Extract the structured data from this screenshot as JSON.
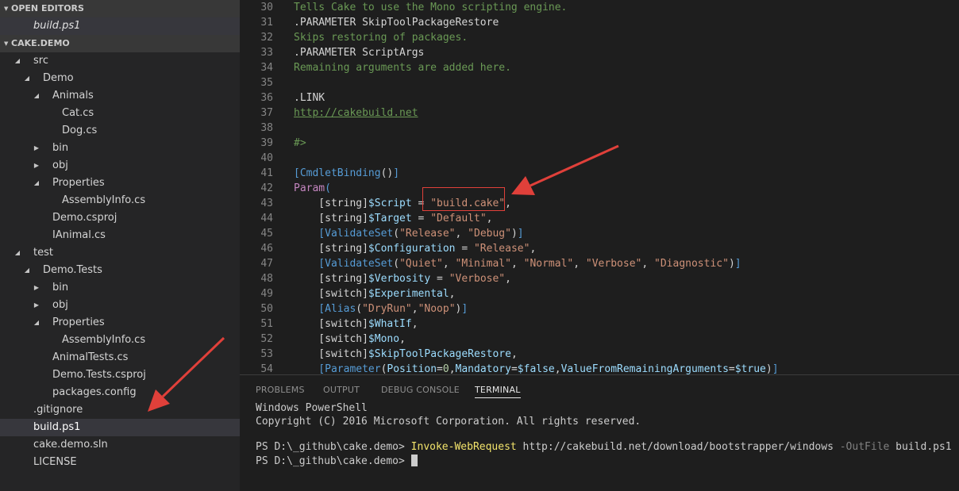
{
  "explorer": {
    "open_editors_title": "OPEN EDITORS",
    "open_editors": [
      "build.ps1"
    ],
    "project_title": "CAKE.DEMO",
    "tree": [
      {
        "label": "src",
        "depth": 0,
        "twisty": "open"
      },
      {
        "label": "Demo",
        "depth": 1,
        "twisty": "open"
      },
      {
        "label": "Animals",
        "depth": 2,
        "twisty": "open"
      },
      {
        "label": "Cat.cs",
        "depth": 3,
        "twisty": "none"
      },
      {
        "label": "Dog.cs",
        "depth": 3,
        "twisty": "none"
      },
      {
        "label": "bin",
        "depth": 2,
        "twisty": "closed"
      },
      {
        "label": "obj",
        "depth": 2,
        "twisty": "closed"
      },
      {
        "label": "Properties",
        "depth": 2,
        "twisty": "open"
      },
      {
        "label": "AssemblyInfo.cs",
        "depth": 3,
        "twisty": "none"
      },
      {
        "label": "Demo.csproj",
        "depth": 2,
        "twisty": "none"
      },
      {
        "label": "IAnimal.cs",
        "depth": 2,
        "twisty": "none"
      },
      {
        "label": "test",
        "depth": 0,
        "twisty": "open"
      },
      {
        "label": "Demo.Tests",
        "depth": 1,
        "twisty": "open"
      },
      {
        "label": "bin",
        "depth": 2,
        "twisty": "closed"
      },
      {
        "label": "obj",
        "depth": 2,
        "twisty": "closed"
      },
      {
        "label": "Properties",
        "depth": 2,
        "twisty": "open"
      },
      {
        "label": "AssemblyInfo.cs",
        "depth": 3,
        "twisty": "none"
      },
      {
        "label": "AnimalTests.cs",
        "depth": 2,
        "twisty": "none"
      },
      {
        "label": "Demo.Tests.csproj",
        "depth": 2,
        "twisty": "none"
      },
      {
        "label": "packages.config",
        "depth": 2,
        "twisty": "none"
      },
      {
        "label": ".gitignore",
        "depth": 0,
        "twisty": "none"
      },
      {
        "label": "build.ps1",
        "depth": 0,
        "twisty": "none",
        "selected": true
      },
      {
        "label": "cake.demo.sln",
        "depth": 0,
        "twisty": "none"
      },
      {
        "label": "LICENSE",
        "depth": 0,
        "twisty": "none"
      }
    ]
  },
  "editor": {
    "lines": [
      {
        "n": "30",
        "tokens": [
          [
            "cm",
            "Tells Cake to use the Mono scripting engine."
          ]
        ]
      },
      {
        "n": "31",
        "tokens": [
          [
            "pl",
            ".PARAMETER SkipToolPackageRestore"
          ]
        ]
      },
      {
        "n": "32",
        "tokens": [
          [
            "cm",
            "Skips restoring of packages."
          ]
        ]
      },
      {
        "n": "33",
        "tokens": [
          [
            "pl",
            ".PARAMETER ScriptArgs"
          ]
        ]
      },
      {
        "n": "34",
        "tokens": [
          [
            "cm",
            "Remaining arguments are added here."
          ]
        ]
      },
      {
        "n": "35",
        "tokens": []
      },
      {
        "n": "36",
        "tokens": [
          [
            "pl",
            ".LINK"
          ]
        ]
      },
      {
        "n": "37",
        "tokens": [
          [
            "lk",
            "http://cakebuild.net"
          ]
        ]
      },
      {
        "n": "38",
        "tokens": []
      },
      {
        "n": "39",
        "tokens": [
          [
            "cm",
            "#>"
          ]
        ]
      },
      {
        "n": "40",
        "tokens": []
      },
      {
        "n": "41",
        "tokens": [
          [
            "at",
            "[CmdletBinding"
          ],
          [
            "pl",
            "()"
          ],
          [
            "at",
            "]"
          ]
        ]
      },
      {
        "n": "42",
        "tokens": [
          [
            "kw",
            "Param"
          ],
          [
            "at",
            "("
          ]
        ]
      },
      {
        "n": "43",
        "tokens": [
          [
            "pl",
            "    [string]"
          ],
          [
            "vr",
            "$Script"
          ],
          [
            "pl",
            " = "
          ],
          [
            "st",
            "\"build.cake\""
          ],
          [
            "pl",
            ","
          ]
        ]
      },
      {
        "n": "44",
        "tokens": [
          [
            "pl",
            "    [string]"
          ],
          [
            "vr",
            "$Target"
          ],
          [
            "pl",
            " = "
          ],
          [
            "st",
            "\"Default\""
          ],
          [
            "pl",
            ","
          ]
        ]
      },
      {
        "n": "45",
        "tokens": [
          [
            "at",
            "    [ValidateSet"
          ],
          [
            "pl",
            "("
          ],
          [
            "st",
            "\"Release\""
          ],
          [
            "pl",
            ", "
          ],
          [
            "st",
            "\"Debug\""
          ],
          [
            "pl",
            ")"
          ],
          [
            "at",
            "]"
          ]
        ]
      },
      {
        "n": "46",
        "tokens": [
          [
            "pl",
            "    [string]"
          ],
          [
            "vr",
            "$Configuration"
          ],
          [
            "pl",
            " = "
          ],
          [
            "st",
            "\"Release\""
          ],
          [
            "pl",
            ","
          ]
        ]
      },
      {
        "n": "47",
        "tokens": [
          [
            "at",
            "    [ValidateSet"
          ],
          [
            "pl",
            "("
          ],
          [
            "st",
            "\"Quiet\""
          ],
          [
            "pl",
            ", "
          ],
          [
            "st",
            "\"Minimal\""
          ],
          [
            "pl",
            ", "
          ],
          [
            "st",
            "\"Normal\""
          ],
          [
            "pl",
            ", "
          ],
          [
            "st",
            "\"Verbose\""
          ],
          [
            "pl",
            ", "
          ],
          [
            "st",
            "\"Diagnostic\""
          ],
          [
            "pl",
            ")"
          ],
          [
            "at",
            "]"
          ]
        ]
      },
      {
        "n": "48",
        "tokens": [
          [
            "pl",
            "    [string]"
          ],
          [
            "vr",
            "$Verbosity"
          ],
          [
            "pl",
            " = "
          ],
          [
            "st",
            "\"Verbose\""
          ],
          [
            "pl",
            ","
          ]
        ]
      },
      {
        "n": "49",
        "tokens": [
          [
            "pl",
            "    [switch]"
          ],
          [
            "vr",
            "$Experimental"
          ],
          [
            "pl",
            ","
          ]
        ]
      },
      {
        "n": "50",
        "tokens": [
          [
            "at",
            "    [Alias"
          ],
          [
            "pl",
            "("
          ],
          [
            "st",
            "\"DryRun\""
          ],
          [
            "pl",
            ","
          ],
          [
            "st",
            "\"Noop\""
          ],
          [
            "pl",
            ")"
          ],
          [
            "at",
            "]"
          ]
        ]
      },
      {
        "n": "51",
        "tokens": [
          [
            "pl",
            "    [switch]"
          ],
          [
            "vr",
            "$WhatIf"
          ],
          [
            "pl",
            ","
          ]
        ]
      },
      {
        "n": "52",
        "tokens": [
          [
            "pl",
            "    [switch]"
          ],
          [
            "vr",
            "$Mono"
          ],
          [
            "pl",
            ","
          ]
        ]
      },
      {
        "n": "53",
        "tokens": [
          [
            "pl",
            "    [switch]"
          ],
          [
            "vr",
            "$SkipToolPackageRestore"
          ],
          [
            "pl",
            ","
          ]
        ]
      },
      {
        "n": "54",
        "tokens": [
          [
            "at",
            "    [Parameter"
          ],
          [
            "pl",
            "("
          ],
          [
            "vr",
            "Position"
          ],
          [
            "pl",
            "="
          ],
          [
            "nm",
            "0"
          ],
          [
            "pl",
            ","
          ],
          [
            "vr",
            "Mandatory"
          ],
          [
            "pl",
            "="
          ],
          [
            "vr",
            "$false"
          ],
          [
            "pl",
            ","
          ],
          [
            "vr",
            "ValueFromRemainingArguments"
          ],
          [
            "pl",
            "="
          ],
          [
            "vr",
            "$true"
          ],
          [
            "pl",
            ")"
          ],
          [
            "at",
            "]"
          ]
        ]
      }
    ]
  },
  "panel": {
    "tabs": [
      {
        "label": "PROBLEMS",
        "active": false
      },
      {
        "label": "OUTPUT",
        "active": false
      },
      {
        "label": "DEBUG CONSOLE",
        "active": false
      },
      {
        "label": "TERMINAL",
        "active": true
      }
    ],
    "terminal": {
      "line1": "Windows PowerShell",
      "line2": "Copyright (C) 2016 Microsoft Corporation. All rights reserved.",
      "prompt": "PS D:\\_github\\cake.demo> ",
      "cmd_name": "Invoke-WebRequest",
      "cmd_url": " http://cakebuild.net/download/bootstrapper/windows ",
      "cmd_flag": "-OutFile",
      "cmd_file": " build.ps1"
    }
  },
  "colors": {
    "annotation_red": "#e0403a",
    "sidebar_bg": "#252526",
    "editor_bg": "#1e1e1e"
  }
}
